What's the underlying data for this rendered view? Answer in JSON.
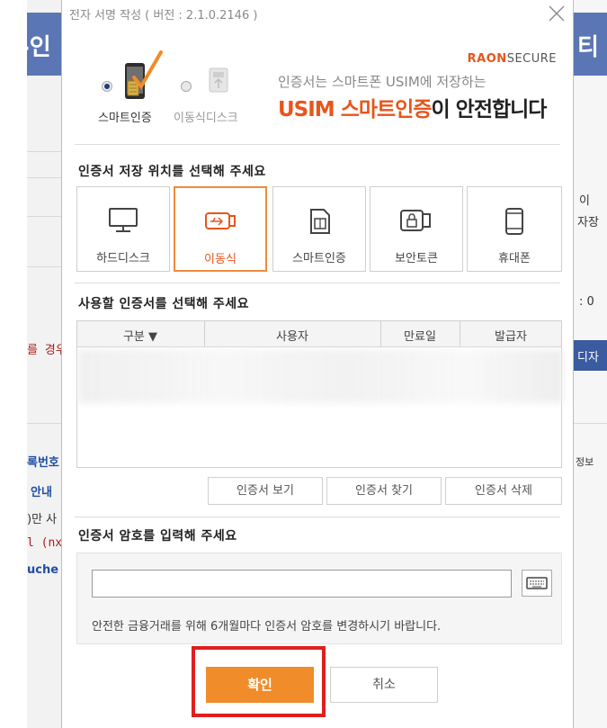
{
  "background": {
    "left_banner_text": "-인",
    "right_banner_text": "티",
    "left_fragments": [
      {
        "text": "를 경우",
        "style": "red"
      },
      {
        "text": "록번호",
        "style": "blue"
      },
      {
        "text": "안내",
        "style": "blue"
      },
      {
        "text": ")만 사",
        "style": "dark"
      },
      {
        "text": "l (nx",
        "style": "red"
      },
      {
        "text": "uche",
        "style": "blue"
      }
    ],
    "right_fragments": [
      {
        "text": "이"
      },
      {
        "text": "자장"
      },
      {
        "text": ": 0"
      },
      {
        "text": "정보"
      }
    ],
    "right_button_label": "디자"
  },
  "dialog": {
    "title": "전자 서명 작성 ( 버전 : 2.1.0.2146 )",
    "close_icon": "close-icon",
    "banner": {
      "option_smart": "스마트인증",
      "option_removable": "이동식디스크",
      "brand_main": "RAON",
      "brand_sub": "SECURE",
      "tagline_small": "인증서는 스마트폰 USIM에 저장하는",
      "tagline_accent": "USIM 스마트인증",
      "tagline_rest": "이 안전합니다"
    },
    "storage_section_title": "인증서 저장 위치를 선택해 주세요",
    "storage_options": [
      {
        "label": "하드디스크",
        "icon": "monitor-icon",
        "selected": false
      },
      {
        "label": "이동식",
        "icon": "usb-drive-icon",
        "selected": true
      },
      {
        "label": "스마트인증",
        "icon": "sim-card-icon",
        "selected": false
      },
      {
        "label": "보안토큰",
        "icon": "security-token-icon",
        "selected": false
      },
      {
        "label": "휴대폰",
        "icon": "mobile-phone-icon",
        "selected": false
      }
    ],
    "cert_section_title": "사용할 인증서를 선택해 주세요",
    "table_headers": [
      "구분 ▼",
      "사용자",
      "만료일",
      "발급자"
    ],
    "cert_buttons": [
      "인증서 보기",
      "인증서 찾기",
      "인증서 삭제"
    ],
    "password_section_title": "인증서 암호를 입력해 주세요",
    "password_value": "",
    "password_note": "안전한 금융거래를 위해 6개월마다 인증서 암호를 변경하시기 바랍니다.",
    "ok_label": "확인",
    "cancel_label": "취소"
  },
  "colors": {
    "accent_orange": "#f08c2a",
    "highlight_red": "#e01e1e",
    "background_blue": "#5b76b4"
  }
}
